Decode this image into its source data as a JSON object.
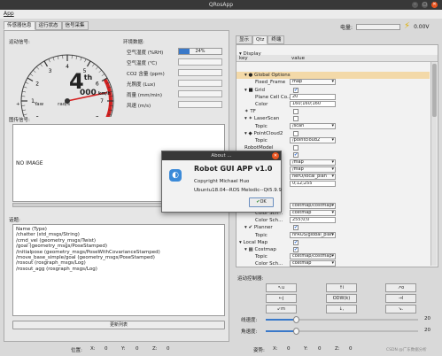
{
  "window": {
    "title": "QRosApp",
    "close_glyph": "✕"
  },
  "menu": {
    "app": "App"
  },
  "top_status": {
    "battery_label": "电量:",
    "voltage": "0.00V"
  },
  "left_tabs": [
    "传感器信息",
    "运行状态",
    "信号采集"
  ],
  "speedometer": {
    "group_label": "运动信号:",
    "ticks": [
      "0",
      "1",
      "2",
      "3",
      "4",
      "5",
      "6",
      "7",
      "8"
    ],
    "gear": "4",
    "gear_suffix": "th",
    "speed": "000",
    "speed_unit": "km/h",
    "yaw_plus": "+",
    "yaw_label": "Yaw",
    "yaw_unit": "rad/s",
    "needle_value": 6.6
  },
  "env": {
    "group_label": "环境数据:",
    "rows": [
      {
        "label": "空气湿度 (%RH)",
        "value": "24%",
        "level": 0.24
      },
      {
        "label": "空气温度 (℃)",
        "value": ""
      },
      {
        "label": "CO2 含量 (ppm)",
        "value": ""
      },
      {
        "label": "光照度 (Lux)",
        "value": ""
      },
      {
        "label": "雨量 (mm/min)",
        "value": ""
      },
      {
        "label": "风速 (m/s)",
        "value": ""
      }
    ]
  },
  "image_signal": {
    "label": "图传信号:",
    "no_image": "NO IMAGE"
  },
  "topics": {
    "label": "话题:",
    "lines": [
      "Name (Type)",
      "/chatter (std_msgs/String)",
      "/cmd_vel (geometry_msgs/Twist)",
      "/goal (geometry_msgs/PoseStamped)",
      "/initialpose (geometry_msgs/PoseWithCovarianceStamped)",
      "/move_base_simple/goal (geometry_msgs/PoseStamped)",
      "/rosout (rosgraph_msgs/Log)",
      "/rosout_agg (rosgraph_msgs/Log)"
    ],
    "refresh_button": "更新列表"
  },
  "statusbar": {
    "position_label": "位置:",
    "x_label": "X:",
    "x": "0",
    "y_label": "Y:",
    "y": "0",
    "z_label": "Z:",
    "z": "0",
    "heading_label": "姿势:",
    "hx_label": "X:",
    "hx": "0",
    "hy_label": "Y:",
    "hy": "0",
    "hz_label": "Z:",
    "hz": "0"
  },
  "right_tabs": [
    "显示",
    "Qtz",
    "终端"
  ],
  "tree": {
    "header_key": "key",
    "header_value": "value",
    "rows": [
      {
        "key": "▾ Display",
        "value": "",
        "indent": 0,
        "type": "none"
      },
      {
        "key": "▾ ● Global Options",
        "value": "",
        "indent": 1,
        "type": "none",
        "highlight": true
      },
      {
        "key": "Fixed_Frame",
        "value": "map",
        "indent": 3,
        "type": "combo"
      },
      {
        "key": "▾ ■ Grid",
        "value": "",
        "indent": 1,
        "type": "check",
        "checked": true
      },
      {
        "key": "Plane Cell Co...",
        "value": "20",
        "indent": 3,
        "type": "edit"
      },
      {
        "key": "Color",
        "value": "160;160;160",
        "indent": 3,
        "type": "edit"
      },
      {
        "key": "✶ TF",
        "value": "",
        "indent": 1,
        "type": "check",
        "checked": false
      },
      {
        "key": "▾ ✶ LaserScan",
        "value": "",
        "indent": 1,
        "type": "check",
        "checked": false
      },
      {
        "key": "Topic",
        "value": "/scan",
        "indent": 3,
        "type": "combo"
      },
      {
        "key": "▾ ◆ PointCloud2",
        "value": "",
        "indent": 1,
        "type": "check",
        "checked": false
      },
      {
        "key": "Topic",
        "value": "/pointcloud2",
        "indent": 3,
        "type": "combo"
      },
      {
        "key": "RobotModel",
        "value": "",
        "indent": 1,
        "type": "check",
        "checked": false
      },
      {
        "key": "▾ ▦ Map",
        "value": "",
        "indent": 1,
        "type": "check",
        "checked": true
      },
      {
        "key": "",
        "value": "/map",
        "indent": 3,
        "type": "combo"
      },
      {
        "key": "",
        "value": "/map",
        "indent": 3,
        "type": "combo"
      },
      {
        "key": "",
        "value": "nerO/local_plan",
        "indent": 3,
        "type": "combo"
      },
      {
        "key": "",
        "value": "0;12;255",
        "indent": 3,
        "type": "edit"
      },
      {
        "key": "",
        "value": "",
        "indent": 3,
        "type": "none"
      },
      {
        "key": "",
        "value": "",
        "indent": 3,
        "type": "none"
      },
      {
        "key": "",
        "value": "costmap/costmap",
        "indent": 3,
        "type": "combo"
      },
      {
        "key": "Color Sch...",
        "value": "costmap",
        "indent": 3,
        "type": "combo"
      },
      {
        "key": "Color Sch...",
        "value": "255;0;0",
        "indent": 3,
        "type": "edit"
      },
      {
        "key": "▾ ✔ Planner",
        "value": "",
        "indent": 1,
        "type": "check",
        "checked": true
      },
      {
        "key": "Topic",
        "value": "nrROS/global_plan",
        "indent": 3,
        "type": "combo"
      },
      {
        "key": "▾ Local Map",
        "value": "",
        "indent": 0,
        "type": "check",
        "checked": true
      },
      {
        "key": "▾ ▦ Costmap",
        "value": "",
        "indent": 1,
        "type": "check",
        "checked": true
      },
      {
        "key": "Topic",
        "value": "costmap/costmap",
        "indent": 3,
        "type": "combo"
      },
      {
        "key": "Color Sch...",
        "value": "costmap",
        "indent": 3,
        "type": "combo"
      }
    ]
  },
  "motion": {
    "label": "运动控制器:",
    "buttons": [
      {
        "label": "↖u",
        "name": "move-u"
      },
      {
        "label": "↑i",
        "name": "move-i"
      },
      {
        "label": "↗o",
        "name": "move-o"
      },
      {
        "label": "←j",
        "name": "move-j"
      },
      {
        "label": "ODW(k)",
        "name": "move-k"
      },
      {
        "label": "→l",
        "name": "move-l"
      },
      {
        "label": "↙m",
        "name": "move-m"
      },
      {
        "label": "↓,",
        "name": "move-comma"
      },
      {
        "label": "↘.",
        "name": "move-dot"
      }
    ],
    "linear_label": "线速度:",
    "linear_value": "20",
    "linear_level": 0.2,
    "angular_label": "角速度:",
    "angular_value": "20",
    "angular_level": 0.2
  },
  "about": {
    "title": "About ...",
    "app_name": "Robot GUI APP v1.0",
    "copyright": "Copyright Michael Huo",
    "platform": "Ubuntu18.04--ROS Melodic--Qt5.9.9",
    "ok": "OK"
  },
  "watermark": "CSDN @广东数据分析"
}
